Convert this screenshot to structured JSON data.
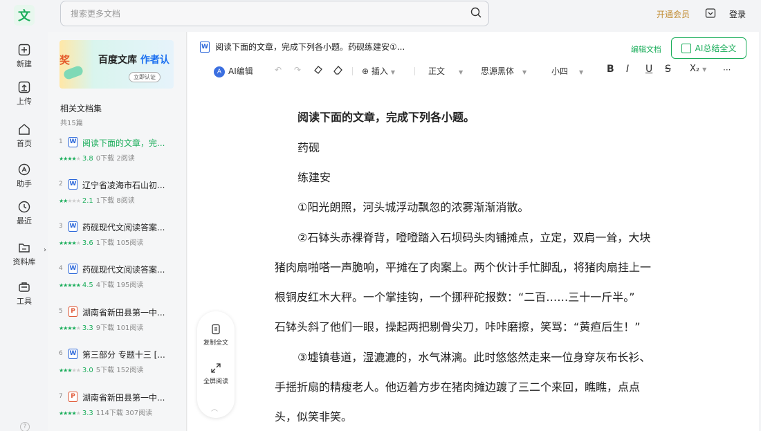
{
  "logo": {
    "glyph": "文"
  },
  "search": {
    "placeholder": "搜索更多文档"
  },
  "header": {
    "member": "开通会员",
    "login": "登录"
  },
  "nav": [
    {
      "id": "new",
      "label": "新建",
      "icon": "plus-icon"
    },
    {
      "id": "upload",
      "label": "上传",
      "icon": "upload-icon"
    },
    {
      "id": "home",
      "label": "首页",
      "icon": "home-icon"
    },
    {
      "id": "assistant",
      "label": "助手",
      "icon": "assistant-icon"
    },
    {
      "id": "recent",
      "label": "最近",
      "icon": "clock-icon"
    },
    {
      "id": "library",
      "label": "资料库",
      "icon": "folder-icon"
    },
    {
      "id": "tools",
      "label": "工具",
      "icon": "toolbox-icon"
    }
  ],
  "help": {
    "glyph": "?"
  },
  "banner": {
    "tag": "奖",
    "title": "百度文库",
    "title_accent": "作者认",
    "button": "立即认证"
  },
  "related": {
    "title": "相关文档集",
    "count": "共15篇",
    "items": [
      {
        "num": "1",
        "type": "W",
        "title": "阅读下面的文章，完...",
        "score": "3.8",
        "downloads": "0下载",
        "reads": "2阅读",
        "stars": 4,
        "active": true
      },
      {
        "num": "2",
        "type": "W",
        "title": "辽宁省凌海市石山初...",
        "score": "2.1",
        "downloads": "1下载",
        "reads": "8阅读",
        "stars": 2
      },
      {
        "num": "3",
        "type": "W",
        "title": "药砚现代文阅读答案...",
        "score": "3.6",
        "downloads": "1下载",
        "reads": "105阅读",
        "stars": 3.5
      },
      {
        "num": "4",
        "type": "W",
        "title": "药砚现代文阅读答案...",
        "score": "4.5",
        "downloads": "4下载",
        "reads": "195阅读",
        "stars": 4.5
      },
      {
        "num": "5",
        "type": "P",
        "title": "湖南省新田县第一中...",
        "score": "3.3",
        "downloads": "9下载",
        "reads": "101阅读",
        "stars": 3.5
      },
      {
        "num": "6",
        "type": "W",
        "title": "第三部分 专题十三 [...",
        "score": "3.0",
        "downloads": "5下载",
        "reads": "152阅读",
        "stars": 3
      },
      {
        "num": "7",
        "type": "P",
        "title": "湖南省新田县第一中...",
        "score": "3.3",
        "downloads": "114下载",
        "reads": "307阅读",
        "stars": 3.5
      }
    ]
  },
  "editor": {
    "doc_title": "阅读下面的文章，完成下列各小题。药砚练建安①...",
    "edit_doc": "编辑文档",
    "ai_summary": "AI总结全文",
    "toolbar": {
      "ai_edit": "AI编辑",
      "insert": "插入",
      "style": "正文",
      "font": "思源黑体",
      "size": "小四",
      "bold": "B",
      "italic": "I",
      "underline": "U",
      "strike": "S",
      "subscript": "X₂",
      "more": "···"
    },
    "paragraphs": [
      "阅读下面的文章，完成下列各小题。",
      "药砚",
      "练建安",
      "①阳光朗照，河头城浮动飘忽的浓雾渐渐消散。",
      "②石钵头赤裸脊背，噔噔踏入石坝码头肉铺摊点，立定，双肩一耸，大块",
      "猪肉扇啪嗒一声脆响，平摊在了肉案上。两个伙计手忙脚乱，将猪肉扇挂上一",
      "根铜皮红木大秤。一个掌挂钩，一个挪秤砣报数：“二百……三十一斤半。”",
      "石钵头斜了他们一眼，操起两把剔骨尖刀，咔咔磨擦，笑骂：“黄疸后生！”",
      "③墟镇巷道，湿漉漉的，水气淋漓。此时悠悠然走来一位身穿灰布长衫、",
      "手摇折扇的精瘦老人。他迈着方步在猪肉摊边踱了三二个来回，瞧瞧，点点",
      "头，似笑非笑。"
    ],
    "float": {
      "copy": "复制全文",
      "fullscreen": "全屏阅读"
    }
  },
  "colors": {
    "accent": "#1aad5a",
    "member": "#c08a2e",
    "word": "#2a66d9",
    "pdf": "#e05b3a"
  }
}
